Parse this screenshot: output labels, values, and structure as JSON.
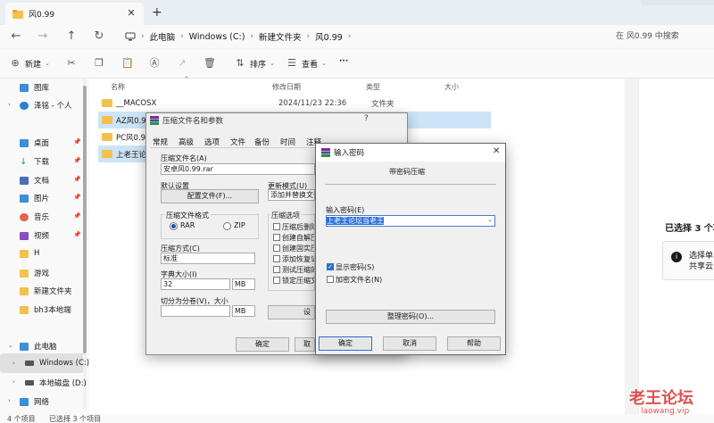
{
  "tab": {
    "title": "风0.99"
  },
  "address": {
    "crumbs": [
      "此电脑",
      "Windows (C:)",
      "新建文件夹",
      "风0.99"
    ],
    "search_placeholder": "在 风0.99 中搜索"
  },
  "toolbar": {
    "new_label": "新建",
    "sort_label": "排序",
    "view_label": "查看",
    "more_label": "···"
  },
  "sidebar": {
    "items": [
      {
        "label": "图库",
        "color": "#3b8ed8"
      },
      {
        "label": "泽铭 - 个人",
        "color": "#2b7fd0"
      },
      {
        "label": "桌面",
        "color": "#3b8ed8"
      },
      {
        "label": "下载",
        "color": "#2d9a5a"
      },
      {
        "label": "文档",
        "color": "#4a6fb8"
      },
      {
        "label": "图片",
        "color": "#3b8ed8"
      },
      {
        "label": "音乐",
        "color": "#e0664a"
      },
      {
        "label": "视频",
        "color": "#8a4bc8"
      },
      {
        "label": "H",
        "color": "#f2c14e"
      },
      {
        "label": "游戏",
        "color": "#f2c14e"
      },
      {
        "label": "新建文件夹",
        "color": "#f2c14e"
      },
      {
        "label": "bh3本地端",
        "color": "#f2c14e"
      },
      {
        "label": "此电脑",
        "color": "#3b8ed8"
      },
      {
        "label": "Windows (C:)",
        "color": "#555555"
      },
      {
        "label": "本地磁盘 (D:)",
        "color": "#555555"
      },
      {
        "label": "网络",
        "color": "#3b8ed8"
      }
    ]
  },
  "columns": {
    "name": "名称",
    "date": "修改日期",
    "type": "类型",
    "size": "大小"
  },
  "files": [
    {
      "name": "__MACOSX",
      "date": "2024/11/23 22:36",
      "type": "文件夹"
    },
    {
      "name": "AZ风0.99",
      "date": "",
      "type": ""
    },
    {
      "name": "PC风0.99",
      "date": "",
      "type": ""
    },
    {
      "name": "上老王论坛",
      "date": "",
      "type": ""
    }
  ],
  "detail": {
    "title": "已选择 3 个项",
    "line1": "选择单",
    "line2": "共享云"
  },
  "status": {
    "count": "4 个项目",
    "selected": "已选择 3 个项目"
  },
  "watermark": {
    "cn": "老王论坛",
    "url": "laowang.vip"
  },
  "rar": {
    "title": "压缩文件名和参数",
    "help": "?",
    "tabs": [
      "常规",
      "高级",
      "选项",
      "文件",
      "备份",
      "时间",
      "注释"
    ],
    "archive_name_label": "压缩文件名(A)",
    "archive_name": "安卓风0.99.rar",
    "profile_label": "默认设置",
    "profile_button": "配置文件(F)...",
    "update_mode_label": "更新模式(U)",
    "update_mode": "添加并替换文件",
    "format_label": "压缩文件格式",
    "format_rar": "RAR",
    "format_zip": "ZIP",
    "method_label": "压缩方式(C)",
    "method": "标准",
    "dict_label": "字典大小(I)",
    "dict_value": "32",
    "dict_unit": "MB",
    "split_label": "切分为分卷(V)，大小",
    "split_unit": "MB",
    "options_label": "压缩选项",
    "options": [
      "压缩后删除原",
      "创建自解压",
      "创建固实压",
      "添加恢复记",
      "测试压缩的",
      "锁定压缩文"
    ],
    "ok": "确定",
    "cancel_partial": "取",
    "set_partial": "设"
  },
  "pwd": {
    "title": "输入密码",
    "subtitle": "带密码压缩",
    "enter_label": "输入密码(E)",
    "password": "上老王论坛当老王",
    "show_pwd": "显示密码(S)",
    "encrypt_names": "加密文件名(N)",
    "organize": "整理密码(O)...",
    "ok": "确定",
    "cancel": "取消",
    "help": "帮助"
  }
}
